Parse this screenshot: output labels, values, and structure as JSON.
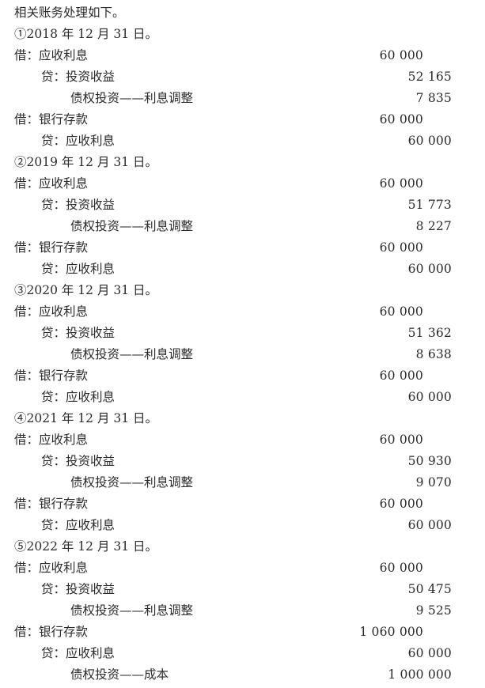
{
  "doc": {
    "intro": "相关账务处理如下。",
    "entries": [
      {
        "date": "①2018 年 12 月 31 日。",
        "lines": [
          {
            "text": "借：应收利息",
            "level": 0,
            "debit": "60 000",
            "credit": ""
          },
          {
            "text": "贷：投资收益",
            "level": 1,
            "debit": "",
            "credit": "52 165"
          },
          {
            "text": "债权投资——利息调整",
            "level": 2,
            "debit": "",
            "credit": "7 835"
          },
          {
            "text": "借：银行存款",
            "level": 0,
            "debit": "60 000",
            "credit": ""
          },
          {
            "text": "贷：应收利息",
            "level": 1,
            "debit": "",
            "credit": "60 000"
          }
        ]
      },
      {
        "date": "②2019 年 12 月 31 日。",
        "lines": [
          {
            "text": "借：应收利息",
            "level": 0,
            "debit": "60 000",
            "credit": ""
          },
          {
            "text": "贷：投资收益",
            "level": 1,
            "debit": "",
            "credit": "51 773"
          },
          {
            "text": "债权投资——利息调整",
            "level": 2,
            "debit": "",
            "credit": "8 227"
          },
          {
            "text": "借：银行存款",
            "level": 0,
            "debit": "60 000",
            "credit": ""
          },
          {
            "text": "贷：应收利息",
            "level": 1,
            "debit": "",
            "credit": "60 000"
          }
        ]
      },
      {
        "date": "③2020 年 12 月 31 日。",
        "lines": [
          {
            "text": "借：应收利息",
            "level": 0,
            "debit": "60 000",
            "credit": ""
          },
          {
            "text": "贷：投资收益",
            "level": 1,
            "debit": "",
            "credit": "51 362"
          },
          {
            "text": "债权投资——利息调整",
            "level": 2,
            "debit": "",
            "credit": "8 638"
          },
          {
            "text": "借：银行存款",
            "level": 0,
            "debit": "60 000",
            "credit": ""
          },
          {
            "text": "贷：应收利息",
            "level": 1,
            "debit": "",
            "credit": "60 000"
          }
        ]
      },
      {
        "date": "④2021 年 12 月 31 日。",
        "lines": [
          {
            "text": "借：应收利息",
            "level": 0,
            "debit": "60 000",
            "credit": ""
          },
          {
            "text": "贷：投资收益",
            "level": 1,
            "debit": "",
            "credit": "50 930"
          },
          {
            "text": "债权投资——利息调整",
            "level": 2,
            "debit": "",
            "credit": "9 070"
          },
          {
            "text": "借：银行存款",
            "level": 0,
            "debit": "60 000",
            "credit": ""
          },
          {
            "text": "贷：应收利息",
            "level": 1,
            "debit": "",
            "credit": "60 000"
          }
        ]
      },
      {
        "date": "⑤2022 年 12 月 31 日。",
        "lines": [
          {
            "text": "借：应收利息",
            "level": 0,
            "debit": "60 000",
            "credit": ""
          },
          {
            "text": "贷：投资收益",
            "level": 1,
            "debit": "",
            "credit": "50 475"
          },
          {
            "text": "债权投资——利息调整",
            "level": 2,
            "debit": "",
            "credit": "9 525"
          },
          {
            "text": "借：银行存款",
            "level": 0,
            "debit": "1 060 000",
            "credit": ""
          },
          {
            "text": "贷：应收利息",
            "level": 1,
            "debit": "",
            "credit": "60 000"
          },
          {
            "text": "债权投资——成本",
            "level": 2,
            "debit": "",
            "credit": "1 000 000"
          }
        ]
      }
    ]
  }
}
